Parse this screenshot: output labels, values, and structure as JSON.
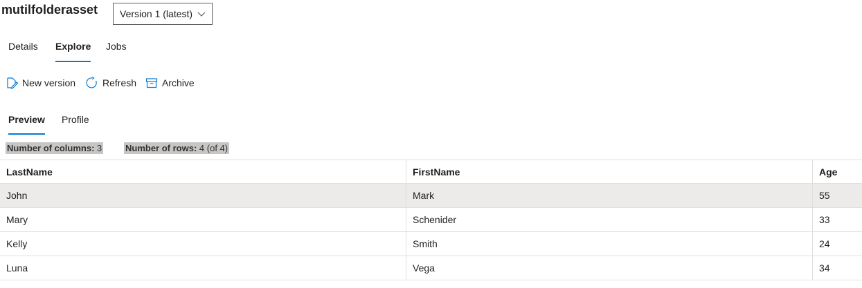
{
  "asset": {
    "name": "mutilfolderasset"
  },
  "version_select": {
    "selected": "Version 1 (latest)"
  },
  "tabs": [
    {
      "label": "Details",
      "active": false
    },
    {
      "label": "Explore",
      "active": true
    },
    {
      "label": "Jobs",
      "active": false
    }
  ],
  "toolbar": {
    "new_version": "New version",
    "refresh": "Refresh",
    "archive": "Archive"
  },
  "subtabs": [
    {
      "label": "Preview",
      "active": true
    },
    {
      "label": "Profile",
      "active": false
    }
  ],
  "stats": {
    "columns_label": "Number of columns:",
    "columns_value": "3",
    "rows_label": "Number of rows:",
    "rows_value": "4 (of 4)"
  },
  "table": {
    "columns": [
      "LastName",
      "FirstName",
      "Age"
    ],
    "rows": [
      [
        "John",
        "Mark",
        "55"
      ],
      [
        "Mary",
        "Schenider",
        "33"
      ],
      [
        "Kelly",
        "Smith",
        "24"
      ],
      [
        "Luna",
        "Vega",
        "34"
      ]
    ],
    "selected_row": 0
  },
  "colors": {
    "accent": "#0078d4",
    "selected_row": "#edebe9",
    "stat_highlight": "#c8c6c4"
  }
}
